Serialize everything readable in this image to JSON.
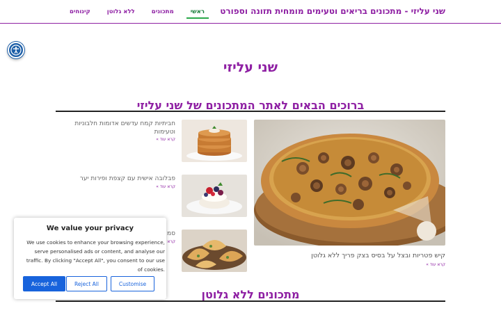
{
  "header": {
    "site_title": "שני עליזי - מתכונים בריאים וטעימים מומחית תזונה וספורט",
    "nav": [
      {
        "label": "ראשי",
        "active": true
      },
      {
        "label": "מתכונים",
        "active": false
      },
      {
        "label": "ללא גלוטן",
        "active": false
      },
      {
        "label": "קינוחים",
        "active": false
      }
    ]
  },
  "accessibility": {
    "icon": "accessibility-icon"
  },
  "main": {
    "page_title": "שני עליזי",
    "welcome_section": {
      "title": "ברוכים הבאים לאתר המתכונים של שני עליזי",
      "featured": {
        "image": "mushroom-quiche-image",
        "title": "קיש פטריות ובצל על בסיס בצק פריך ללא גלוטן",
        "read_more": "קרא עוד »"
      },
      "side_posts": [
        {
          "image": "pancakes-image",
          "title": "חביתיות קמח עדשים אדומות חלבוניות וטעימות",
          "read_more": "קרא עוד »"
        },
        {
          "image": "pavlova-image",
          "title": "פבלובה אישית עם קצפת ופירות יער",
          "read_more": "קרא עוד »"
        },
        {
          "image": "pastries-image",
          "title": "סמ",
          "read_more": "קרא"
        }
      ]
    },
    "gluten_free_section": {
      "title": "מתכונים ללא גלוטן"
    }
  },
  "cookie_banner": {
    "title": "We value your privacy",
    "text": "We use cookies to enhance your browsing experience, serve personalised ads or content, and analyse our traffic. By clicking \"Accept All\", you consent to our use of cookies.",
    "accept_label": "Accept All",
    "reject_label": "Reject All",
    "customise_label": "Customise"
  },
  "colors": {
    "brand": "#8e1fa3",
    "active_nav": "#1b7e3c",
    "cookie_button": "#1863dc"
  }
}
